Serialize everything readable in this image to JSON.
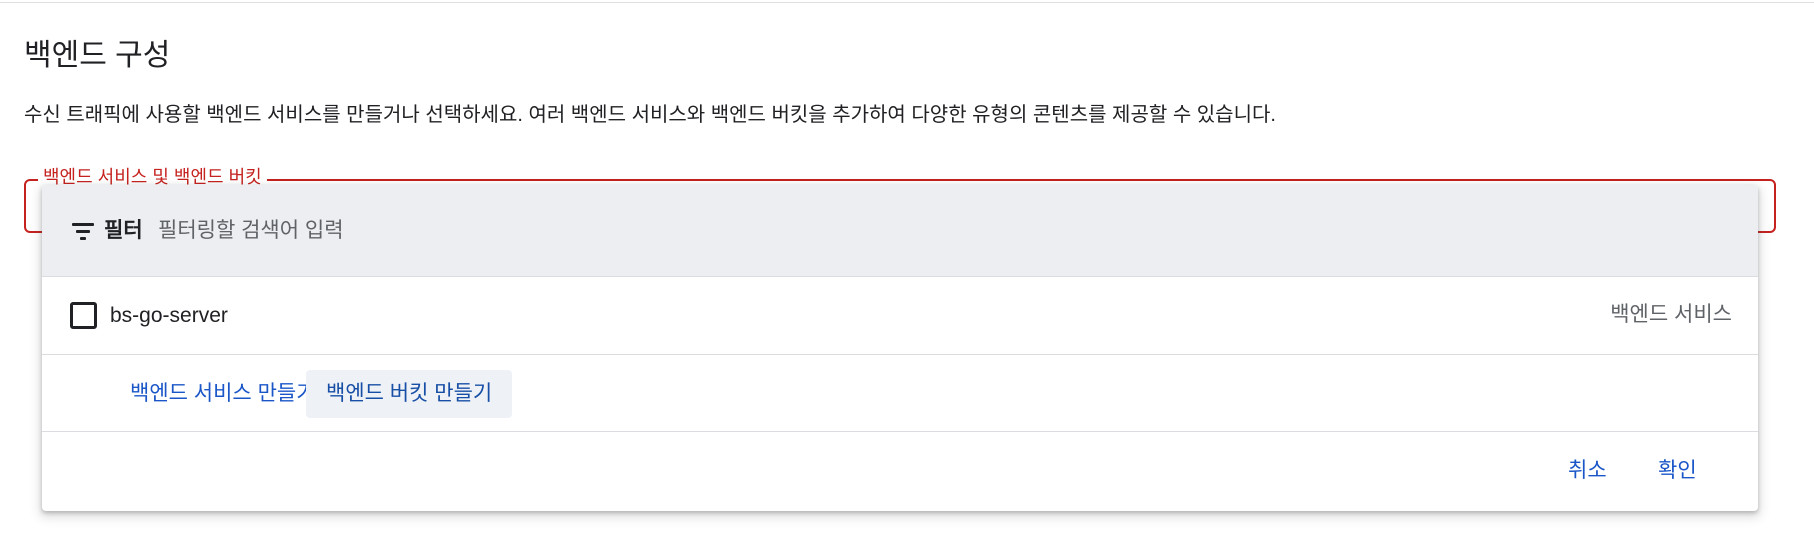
{
  "section": {
    "title": "백엔드 구성",
    "description": "수신 트래픽에 사용할 백엔드 서비스를 만들거나 선택하세요. 여러 백엔드 서비스와 백엔드 버킷을 추가하여 다양한 유형의 콘텐츠를 제공할 수 있습니다."
  },
  "field": {
    "label": "백엔드 서비스 및 백엔드 버킷",
    "state": "error",
    "accent_color": "#c5221f"
  },
  "dropdown": {
    "filter": {
      "icon": "filter-icon",
      "label": "필터",
      "placeholder": "필터링할 검색어 입력",
      "value": ""
    },
    "options": [
      {
        "name": "bs-go-server",
        "type": "백엔드 서비스",
        "checked": false
      }
    ],
    "actions": {
      "create_service": "백엔드 서비스 만들기",
      "create_bucket": "백엔드 버킷 만들기"
    },
    "footer": {
      "cancel": "취소",
      "ok": "확인"
    }
  },
  "colors": {
    "link": "#1a56c7",
    "filter_bar_bg": "#eceef1",
    "text_primary": "#202124",
    "text_secondary": "#5f6368"
  }
}
